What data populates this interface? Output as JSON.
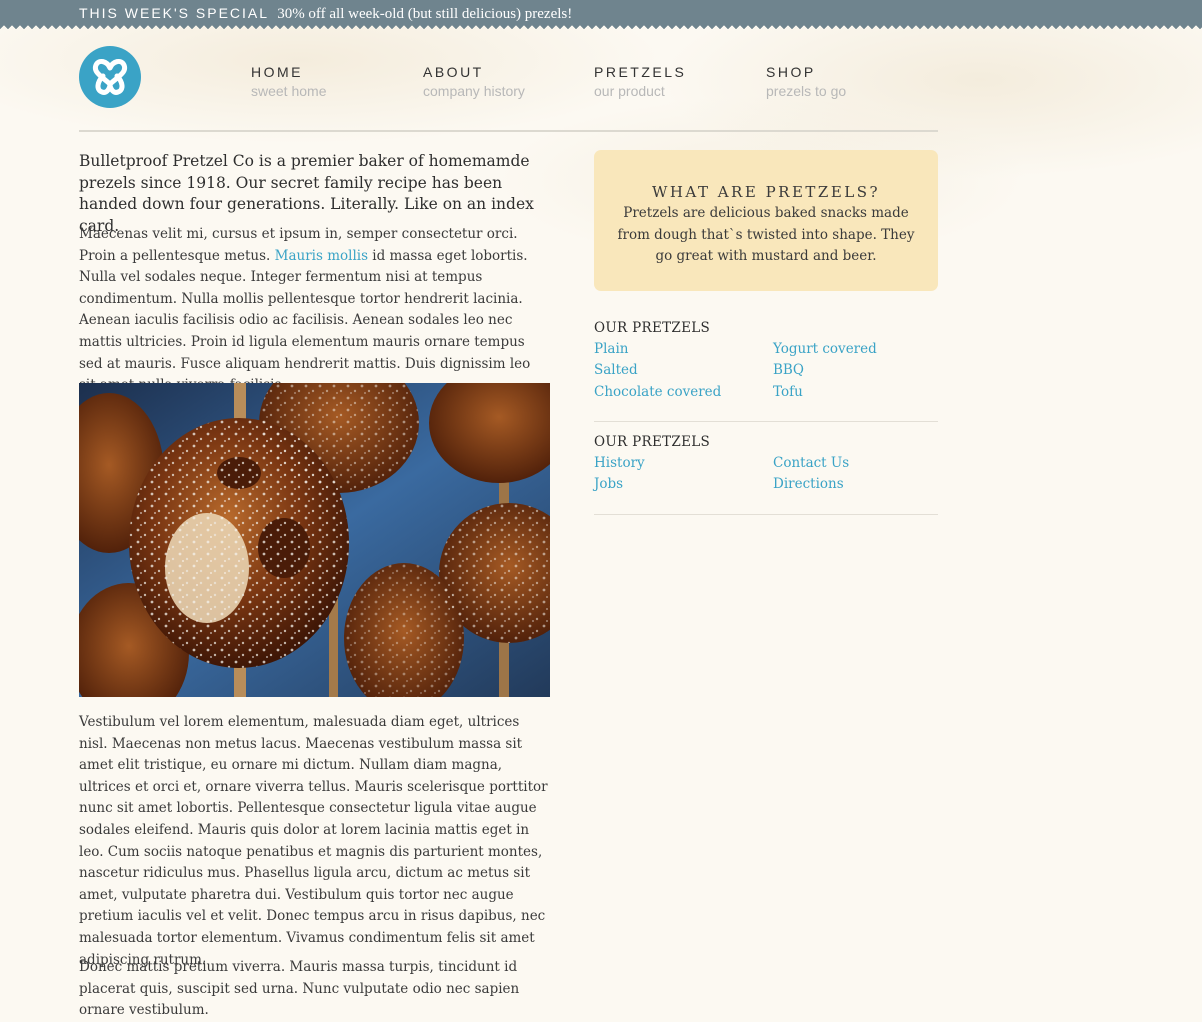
{
  "promo": {
    "label": "THIS WEEK'S SPECIAL",
    "message": "30% off all week-old (but still delicious) prezels!"
  },
  "nav": [
    {
      "title": "HOME",
      "subtitle": "sweet home"
    },
    {
      "title": "ABOUT",
      "subtitle": "company history"
    },
    {
      "title": "PRETZELS",
      "subtitle": "our product"
    },
    {
      "title": "SHOP",
      "subtitle": "prezels to go"
    }
  ],
  "main": {
    "intro": "Bulletproof Pretzel Co is a premier baker of homemamde prezels since 1918. Our secret family recipe has been handed down four generations. Literally. Like on an index card.",
    "para1_before": "Maecenas velit mi, cursus et ipsum in, semper consectetur orci. Proin a pellentesque metus. ",
    "para1_link": "Mauris mollis",
    "para1_after": " id massa eget lobortis. Nulla vel sodales neque. Integer fermentum nisi at tempus condimentum. Nulla mollis pellentesque tortor hendrerit lacinia. Aenean iaculis facilisis odio ac facilisis. Aenean sodales leo nec mattis ultricies. Proin id ligula elementum mauris ornare tempus sed at mauris. Fusce aliquam hendrerit mattis. Duis dignissim leo sit amet nulla viverra facilisis.",
    "para2": "Vestibulum vel lorem elementum, malesuada diam eget, ultrices nisl. Maecenas non metus lacus. Maecenas vestibulum massa sit amet elit tristique, eu ornare mi dictum. Nullam diam magna, ultrices et orci et, ornare viverra tellus. Mauris scelerisque porttitor nunc sit amet lobortis. Pellentesque consectetur ligula vitae augue sodales eleifend. Mauris quis dolor at lorem lacinia mattis eget in leo. Cum sociis natoque penatibus et magnis dis parturient montes, nascetur ridiculus mus. Phasellus ligula arcu, dictum ac metus sit amet, vulputate pharetra dui. Vestibulum quis tortor nec augue pretium iaculis vel et velit. Donec tempus arcu in risus dapibus, nec malesuada tortor elementum. Vivamus condimentum felis sit amet adipiscing rutrum.",
    "para3": "Donec mattis pretium viverra. Mauris massa turpis, tincidunt id placerat quis, suscipit sed urna. Nunc vulputate odio nec sapien ornare vestibulum."
  },
  "sidebar": {
    "box_title": "WHAT ARE PRETZELS?",
    "box_text": "Pretzels are delicious baked snacks made from dough that`s twisted into shape. They go great with mustard and beer.",
    "section1": {
      "heading": "OUR PRETZELS",
      "links": [
        "Plain",
        "Yogurt covered",
        "Salted",
        "BBQ",
        "Chocolate covered",
        "Tofu"
      ]
    },
    "section2": {
      "heading": "OUR PRETZELS",
      "links": [
        "History",
        "Contact Us",
        "Jobs",
        "Directions"
      ]
    }
  },
  "colors": {
    "promo_bar": "#6f848e",
    "accent_link": "#3aa3c6",
    "callout_bg": "#f9e7bb",
    "page_bg": "#fcf9f2"
  },
  "icons": {
    "logo": "pretzel-logo-icon"
  }
}
